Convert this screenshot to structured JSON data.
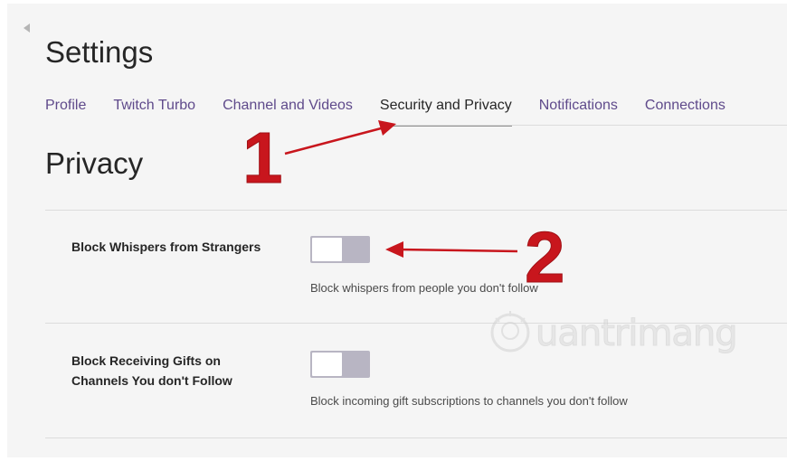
{
  "page": {
    "title": "Settings"
  },
  "tabs": [
    {
      "label": "Profile",
      "active": false
    },
    {
      "label": "Twitch Turbo",
      "active": false
    },
    {
      "label": "Channel and Videos",
      "active": false
    },
    {
      "label": "Security and Privacy",
      "active": true
    },
    {
      "label": "Notifications",
      "active": false
    },
    {
      "label": "Connections",
      "active": false
    }
  ],
  "section": {
    "title": "Privacy"
  },
  "settings": [
    {
      "label": "Block Whispers from Strangers",
      "label_lines": [
        "Block Whispers from Strangers"
      ],
      "toggle_on": false,
      "description": "Block whispers from people you don't follow"
    },
    {
      "label": "Block Receiving Gifts on Channels You don't Follow",
      "label_lines": [
        "Block Receiving Gifts on",
        "Channels You don't Follow"
      ],
      "toggle_on": false,
      "description": "Block incoming gift subscriptions to channels you don't follow"
    }
  ],
  "annotations": {
    "step1": "1",
    "step2": "2",
    "color": "#c8161d"
  },
  "watermark": {
    "text": "uantrimang"
  },
  "colors": {
    "tab_link": "#5f4a8b",
    "toggle_track": "#b8b5c3"
  }
}
